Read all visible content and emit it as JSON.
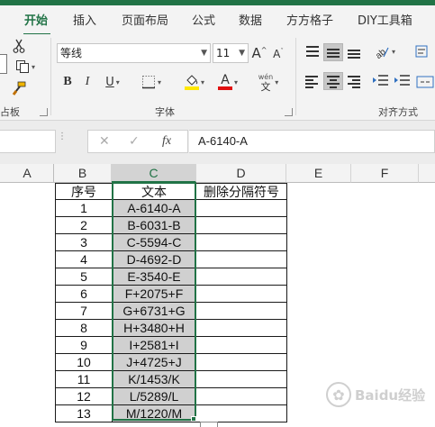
{
  "tabs": [
    "开始",
    "插入",
    "页面布局",
    "公式",
    "数据",
    "方方格子",
    "DIY工具箱"
  ],
  "ribbon": {
    "clipboard_label": "粘贴板",
    "clipboard_label_visible": "占板",
    "font_name": "等线",
    "font_size": "11",
    "grow_font": "A",
    "shrink_font": "A",
    "bold": "B",
    "italic": "I",
    "underline": "U",
    "font_color": "A",
    "phonetic_top": "wén",
    "phonetic_bottom": "文",
    "font_group_label": "字体",
    "align_group_label": "对齐方式",
    "colors": {
      "highlight": "#ffe800",
      "font_color": "#e01010",
      "accent": "#217346"
    }
  },
  "formula_bar": {
    "cancel": "✕",
    "enter": "✓",
    "fx": "fx",
    "value": "A-6140-A"
  },
  "columns": [
    "A",
    "B",
    "C",
    "D",
    "E",
    "F"
  ],
  "table": {
    "headers": [
      "序号",
      "文本",
      "删除分隔符号"
    ],
    "rows": [
      [
        "1",
        "A-6140-A"
      ],
      [
        "2",
        "B-6031-B"
      ],
      [
        "3",
        "C-5594-C"
      ],
      [
        "4",
        "D-4692-D"
      ],
      [
        "5",
        "E-3540-E"
      ],
      [
        "6",
        "F+2075+F"
      ],
      [
        "7",
        "G+6731+G"
      ],
      [
        "8",
        "H+3480+H"
      ],
      [
        "9",
        "I+2581+I"
      ],
      [
        "10",
        "J+4725+J"
      ],
      [
        "11",
        "K/1453/K"
      ],
      [
        "12",
        "L/5289/L"
      ],
      [
        "13",
        "M/1220/M"
      ]
    ]
  },
  "watermark": "Baidu经验"
}
